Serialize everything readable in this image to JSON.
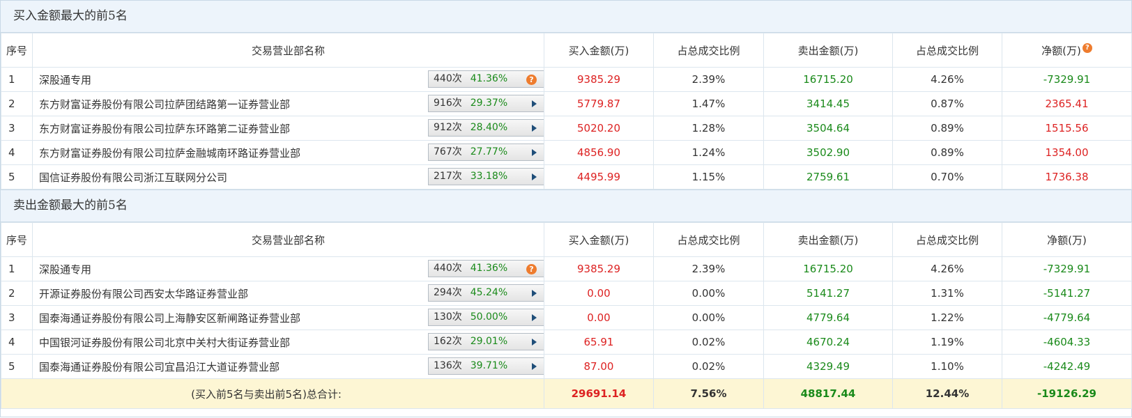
{
  "buy_section": {
    "title": "买入金额最大的前5名",
    "headers": [
      "序号",
      "交易营业部名称",
      "买入金额(万)",
      "占总成交比例",
      "卖出金额(万)",
      "占总成交比例",
      "净额(万)"
    ],
    "rows": [
      {
        "idx": "1",
        "name": "深股通专用",
        "times": "440次",
        "pct": "41.36%",
        "badge_icon": "question-icon",
        "buy": "9385.29",
        "buy_ratio": "2.39%",
        "sell": "16715.20",
        "sell_ratio": "4.26%",
        "net": "-7329.91"
      },
      {
        "idx": "2",
        "name": "东方财富证券股份有限公司拉萨团结路第一证券营业部",
        "times": "916次",
        "pct": "29.37%",
        "badge_icon": "play-arrow-icon",
        "buy": "5779.87",
        "buy_ratio": "1.47%",
        "sell": "3414.45",
        "sell_ratio": "0.87%",
        "net": "2365.41"
      },
      {
        "idx": "3",
        "name": "东方财富证券股份有限公司拉萨东环路第二证券营业部",
        "times": "912次",
        "pct": "28.40%",
        "badge_icon": "play-arrow-icon",
        "buy": "5020.20",
        "buy_ratio": "1.28%",
        "sell": "3504.64",
        "sell_ratio": "0.89%",
        "net": "1515.56"
      },
      {
        "idx": "4",
        "name": "东方财富证券股份有限公司拉萨金融城南环路证券营业部",
        "times": "767次",
        "pct": "27.77%",
        "badge_icon": "play-arrow-icon",
        "buy": "4856.90",
        "buy_ratio": "1.24%",
        "sell": "3502.90",
        "sell_ratio": "0.89%",
        "net": "1354.00"
      },
      {
        "idx": "5",
        "name": "国信证券股份有限公司浙江互联网分公司",
        "times": "217次",
        "pct": "33.18%",
        "badge_icon": "play-arrow-icon",
        "buy": "4495.99",
        "buy_ratio": "1.15%",
        "sell": "2759.61",
        "sell_ratio": "0.70%",
        "net": "1736.38"
      }
    ]
  },
  "sell_section": {
    "title": "卖出金额最大的前5名",
    "headers": [
      "序号",
      "交易营业部名称",
      "买入金额(万)",
      "占总成交比例",
      "卖出金额(万)",
      "占总成交比例",
      "净额(万)"
    ],
    "rows": [
      {
        "idx": "1",
        "name": "深股通专用",
        "times": "440次",
        "pct": "41.36%",
        "badge_icon": "question-icon",
        "buy": "9385.29",
        "buy_ratio": "2.39%",
        "sell": "16715.20",
        "sell_ratio": "4.26%",
        "net": "-7329.91"
      },
      {
        "idx": "2",
        "name": "开源证券股份有限公司西安太华路证券营业部",
        "times": "294次",
        "pct": "45.24%",
        "badge_icon": "play-arrow-icon",
        "buy": "0.00",
        "buy_ratio": "0.00%",
        "sell": "5141.27",
        "sell_ratio": "1.31%",
        "net": "-5141.27"
      },
      {
        "idx": "3",
        "name": "国泰海通证券股份有限公司上海静安区新闸路证券营业部",
        "times": "130次",
        "pct": "50.00%",
        "badge_icon": "play-arrow-icon",
        "buy": "0.00",
        "buy_ratio": "0.00%",
        "sell": "4779.64",
        "sell_ratio": "1.22%",
        "net": "-4779.64"
      },
      {
        "idx": "4",
        "name": "中国银河证券股份有限公司北京中关村大街证券营业部",
        "times": "162次",
        "pct": "29.01%",
        "badge_icon": "play-arrow-icon",
        "buy": "65.91",
        "buy_ratio": "0.02%",
        "sell": "4670.24",
        "sell_ratio": "1.19%",
        "net": "-4604.33"
      },
      {
        "idx": "5",
        "name": "国泰海通证券股份有限公司宜昌沿江大道证券营业部",
        "times": "136次",
        "pct": "39.71%",
        "badge_icon": "play-arrow-icon",
        "buy": "87.00",
        "buy_ratio": "0.02%",
        "sell": "4329.49",
        "sell_ratio": "1.10%",
        "net": "-4242.49"
      }
    ],
    "total": {
      "label": "(买入前5名与卖出前5名)总合计:",
      "buy": "29691.14",
      "buy_ratio": "7.56%",
      "sell": "48817.44",
      "sell_ratio": "12.44%",
      "net": "-19126.29"
    }
  },
  "icons": {
    "question": "?"
  },
  "colors": {
    "positive": "#dd2222",
    "negative": "#1a8a1a",
    "header_bg": "#edf4fb",
    "total_bg": "#fdf6d4",
    "badge_icon": "#ee7c2e",
    "arrow": "#1f4e79"
  }
}
